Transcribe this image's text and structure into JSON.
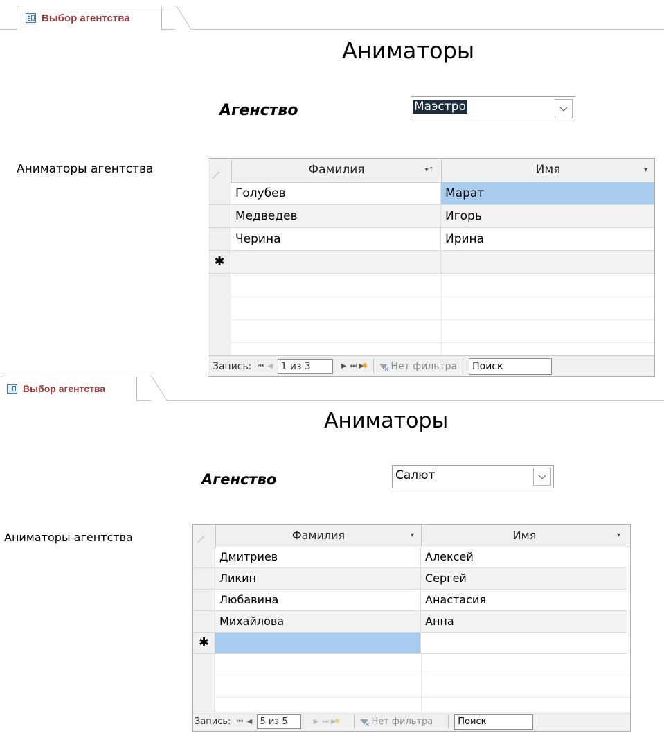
{
  "panel1": {
    "tab": {
      "label": "Выбор агентства"
    },
    "title": "Аниматоры",
    "agency": {
      "label": "Агенство",
      "value": "Маэстро"
    },
    "subform_label": "Аниматоры агентства",
    "grid": {
      "columns": [
        "Фамилия",
        "Имя"
      ],
      "rows": [
        [
          "Голубев",
          "Марат"
        ],
        [
          "Медведев",
          "Игорь"
        ],
        [
          "Черина",
          "Ирина"
        ]
      ],
      "new_row_marker": "✱"
    },
    "nav": {
      "record_label": "Запись:",
      "record_value": "1 из 3",
      "filter_label": "Нет фильтра",
      "search_label": "Поиск"
    }
  },
  "panel2": {
    "tab": {
      "label": "Выбор агентства"
    },
    "title": "Аниматоры",
    "agency": {
      "label": "Агенство",
      "value": "Салют"
    },
    "subform_label": "Аниматоры агентства",
    "grid": {
      "columns": [
        "Фамилия",
        "Имя"
      ],
      "rows": [
        [
          "Дмитриев",
          "Алексей"
        ],
        [
          "Ликин",
          "Сергей"
        ],
        [
          "Любавина",
          "Анастасия"
        ],
        [
          "Михайлова",
          "Анна"
        ]
      ],
      "new_row_marker": "✱"
    },
    "nav": {
      "record_label": "Запись:",
      "record_value": "5 из 5",
      "filter_label": "Нет фильтра",
      "search_label": "Поиск"
    }
  }
}
